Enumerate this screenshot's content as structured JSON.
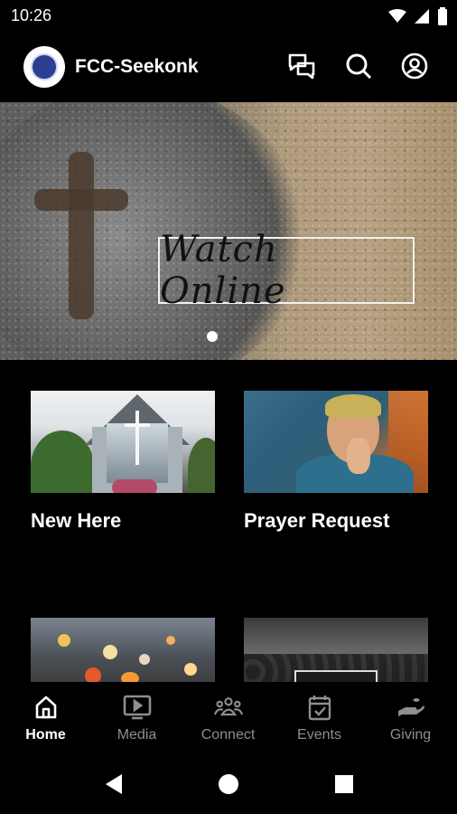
{
  "status_bar": {
    "time": "10:26"
  },
  "header": {
    "app_title": "FCC-Seekonk"
  },
  "hero": {
    "caption": "Watch Online"
  },
  "cards": [
    {
      "label": "New Here"
    },
    {
      "label": "Prayer Request"
    },
    {
      "label": ""
    },
    {
      "label": ""
    }
  ],
  "nav": {
    "items": [
      {
        "label": "Home",
        "icon": "home-icon"
      },
      {
        "label": "Media",
        "icon": "media-icon"
      },
      {
        "label": "Connect",
        "icon": "connect-icon"
      },
      {
        "label": "Events",
        "icon": "events-icon"
      },
      {
        "label": "Giving",
        "icon": "giving-icon"
      }
    ],
    "active": "Home"
  },
  "colors": {
    "background": "#000000",
    "text": "#ffffff",
    "inactive": "#8e8e8e"
  }
}
